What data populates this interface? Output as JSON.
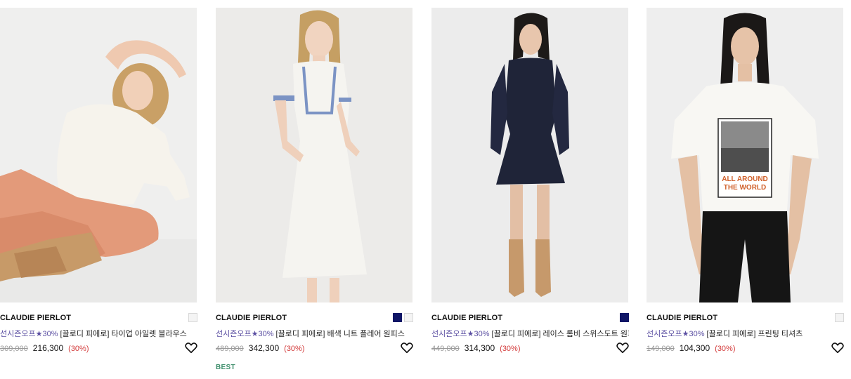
{
  "products": [
    {
      "brand": "CLAUDIE PIERLOT",
      "promo": "선시즌오프★30%",
      "name": "[끌로디 피에로] 타이업 아일렛 블라우스",
      "original_price": "309,000",
      "sale_price": "216,300",
      "discount": "(30%)",
      "swatches": [
        "#f4f4f4"
      ],
      "badge": ""
    },
    {
      "brand": "CLAUDIE PIERLOT",
      "promo": "선시즌오프★30%",
      "name": "[끌로디 피에로] 배색 니트 플레어 원피스",
      "original_price": "489,000",
      "sale_price": "342,300",
      "discount": "(30%)",
      "swatches": [
        "#0f1566",
        "#f4f4f4"
      ],
      "badge": "BEST"
    },
    {
      "brand": "CLAUDIE PIERLOT",
      "promo": "선시즌오프★30%",
      "name": "[끌로디 피에로] 레이스 롬비 스위스도트 원피스",
      "original_price": "449,000",
      "sale_price": "314,300",
      "discount": "(30%)",
      "swatches": [
        "#0f1566"
      ],
      "badge": ""
    },
    {
      "brand": "CLAUDIE PIERLOT",
      "promo": "선시즌오프★30%",
      "name": "[끌로디 피에로] 프린팅 티셔츠",
      "original_price": "149,000",
      "sale_price": "104,300",
      "discount": "(30%)",
      "swatches": [
        "#f4f4f4"
      ],
      "badge": ""
    }
  ],
  "print_text": "ALL AROUND THE WORLD",
  "icons": {
    "wishlist": "heart-outline-icon"
  }
}
